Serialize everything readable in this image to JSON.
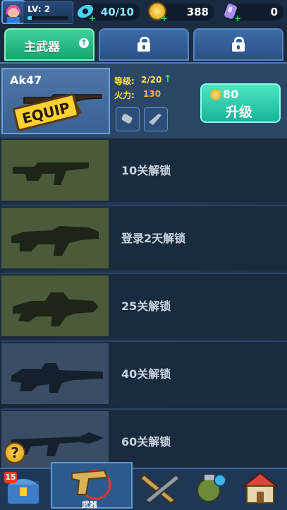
{
  "topbar": {
    "level_label": "LV: 2",
    "level_progress": 0.1,
    "energy": "40/10",
    "coins": "388",
    "gems": "0"
  },
  "tabs": [
    {
      "label": "主武器",
      "locked": false
    },
    {
      "label": "",
      "locked": true
    },
    {
      "label": "",
      "locked": true
    }
  ],
  "equipped": {
    "name": "Ak47",
    "badge": "EQUIP",
    "level_label": "等级:",
    "level_value": "2/20",
    "power_label": "火力:",
    "power_value": "130",
    "upgrade_cost": "80",
    "upgrade_label": "升级"
  },
  "locked_weapons": [
    {
      "label": "10关解锁"
    },
    {
      "label": "登录2天解锁"
    },
    {
      "label": "25关解锁"
    },
    {
      "label": "40关解锁"
    },
    {
      "label": "60关解锁"
    }
  ],
  "help": "?",
  "nav": {
    "chest_badge": "15",
    "active_label": "武器"
  },
  "colors": {
    "accent_green": "#16a56d",
    "tab_blue": "#2a5188",
    "upgrade_teal": "#18b29a",
    "equip_yellow": "#ffd232"
  }
}
